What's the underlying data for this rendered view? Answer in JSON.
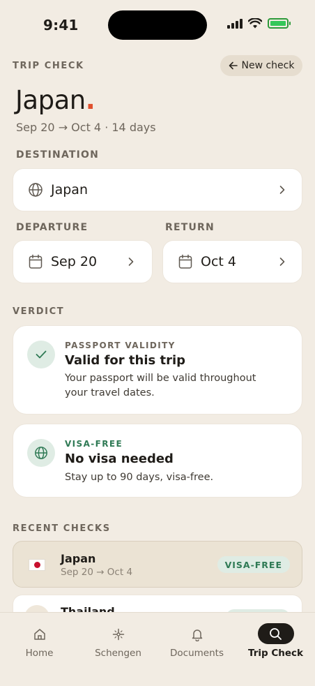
{
  "status_bar": {
    "time": "9:41"
  },
  "header": {
    "eyebrow": "TRIP CHECK",
    "new_check_label": "New check",
    "title": "Japan",
    "title_dot": ".",
    "subtitle": "Sep 20 → Oct 4 · 14 days"
  },
  "destination": {
    "label": "DESTINATION",
    "value": "Japan"
  },
  "departure": {
    "label": "DEPARTURE",
    "value": "Sep 20"
  },
  "return_date": {
    "label": "RETURN",
    "value": "Oct 4"
  },
  "verdict": {
    "label": "VERDICT",
    "cards": [
      {
        "eyebrow": "PASSPORT VALIDITY",
        "title": "Valid for this trip",
        "description": "Your passport will be valid throughout your travel dates.",
        "icon": "check-icon"
      },
      {
        "eyebrow": "VISA-FREE",
        "title": "No visa needed",
        "description": "Stay up to 90 days, visa-free.",
        "icon": "globe-icon"
      }
    ],
    "accent_color": "#2f7a55"
  },
  "recent": {
    "label": "RECENT CHECKS",
    "items": [
      {
        "name": "Japan",
        "dates": "Sep 20 → Oct 4",
        "status": "VISA-FREE",
        "flag": "japan-flag"
      },
      {
        "name": "Thailand"
      }
    ]
  },
  "tabs": [
    {
      "label": "Home",
      "icon": "home-icon"
    },
    {
      "label": "Schengen",
      "icon": "star-compass-icon"
    },
    {
      "label": "Documents",
      "icon": "bell-icon"
    },
    {
      "label": "Trip Check",
      "icon": "search-icon",
      "active": true
    }
  ],
  "colors": {
    "background": "#f2ece3",
    "accent_dot": "#e0502e",
    "success": "#2f7a55"
  }
}
